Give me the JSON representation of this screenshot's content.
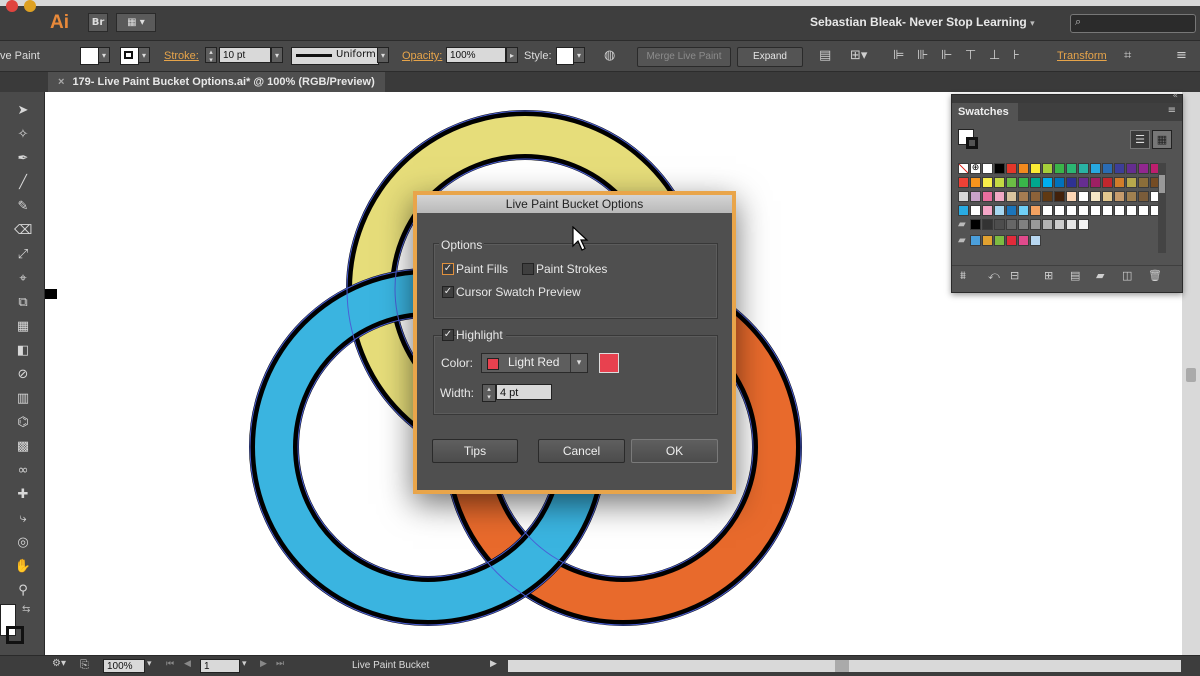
{
  "app": {
    "logo": "Ai",
    "bridge": "Br",
    "workspace": "Sebastian Bleak- Never Stop Learning"
  },
  "control_bar": {
    "mode_label": "ve Paint",
    "stroke_label": "Stroke:",
    "stroke_weight": "10 pt",
    "profile": "Uniform",
    "opacity_label": "Opacity:",
    "opacity_value": "100%",
    "style_label": "Style:",
    "merge_button": "Merge Live Paint",
    "expand_button": "Expand",
    "transform_button": "Transform"
  },
  "document": {
    "tab_title": "179- Live Paint Bucket Options.ai* @ 100% (RGB/Preview)"
  },
  "status_bar": {
    "zoom": "100%",
    "artboard": "1",
    "current_tool": "Live Paint Bucket"
  },
  "swatches_panel": {
    "title": "Swatches",
    "rows": [
      [
        "none",
        "reg",
        "#ffffff",
        "#000000",
        "#e4372a",
        "#f28a1e",
        "#fbec34",
        "#a5cf3a",
        "#3ab449",
        "#2bb673",
        "#29b3a4",
        "#27a9e1",
        "#2a6cb4",
        "#3d3e98",
        "#652d90",
        "#92278f",
        "#be1e6e"
      ],
      [
        "#ef4136",
        "#f7941d",
        "#f7ed4a",
        "#c4da43",
        "#6cbd45",
        "#39b54a",
        "#00a78e",
        "#00aeef",
        "#0072bc",
        "#2e3192",
        "#662d91",
        "#9e1f63",
        "#c1272d",
        "#d07c2a",
        "#b7a84c",
        "#8b6e3a",
        "#754c24"
      ],
      [
        "#d9d9d9",
        "#c8a2c8",
        "#e76e9e",
        "#f1a9c5",
        "#d9c49f",
        "#a67c52",
        "#8c6239",
        "#603913",
        "#42210b",
        "#fcd6b5",
        "#ffffff",
        "#f5e7c6",
        "#e2c78e",
        "#c69c6d",
        "#a08050",
        "#7a5c3a",
        "#ffffff"
      ],
      [
        "#29abe2",
        "#ffffff",
        "#f4a6c7",
        "#a7d7f0",
        "#1b75bb",
        "#6fcff6",
        "#f4a261",
        "#ffffff",
        "#ffffff",
        "#ffffff",
        "#ffffff",
        "#ffffff",
        "#ffffff",
        "#ffffff",
        "#ffffff",
        "#ffffff",
        "#ffffff"
      ],
      [
        "folder",
        "#000000",
        "#333333",
        "#4d4d4d",
        "#666666",
        "#808080",
        "#999999",
        "#b3b3b3",
        "#cccccc",
        "#e6e6e6",
        "#f2f2f2"
      ],
      [
        "folder",
        "#4b9fdb",
        "#e1a130",
        "#7dbb42",
        "#e22b3a",
        "#e04a8c",
        "#b8d7f1"
      ]
    ]
  },
  "dialog": {
    "title": "Live Paint Bucket Options",
    "options_legend": "Options",
    "paint_fills": "Paint Fills",
    "paint_strokes": "Paint Strokes",
    "cursor_preview": "Cursor Swatch Preview",
    "highlight": "Highlight",
    "color_label": "Color:",
    "color_value": "Light Red",
    "highlight_color": "#e8414f",
    "width_label": "Width:",
    "width_value": "4 pt",
    "tips_button": "Tips",
    "cancel_button": "Cancel",
    "ok_button": "OK",
    "states": {
      "paint_fills": true,
      "paint_strokes": false,
      "cursor_preview": true,
      "highlight": true
    }
  },
  "artwork": {
    "colors": {
      "yellow": "#e6dd7a",
      "blue": "#3ab4e0",
      "orange": "#e86a2c"
    }
  }
}
